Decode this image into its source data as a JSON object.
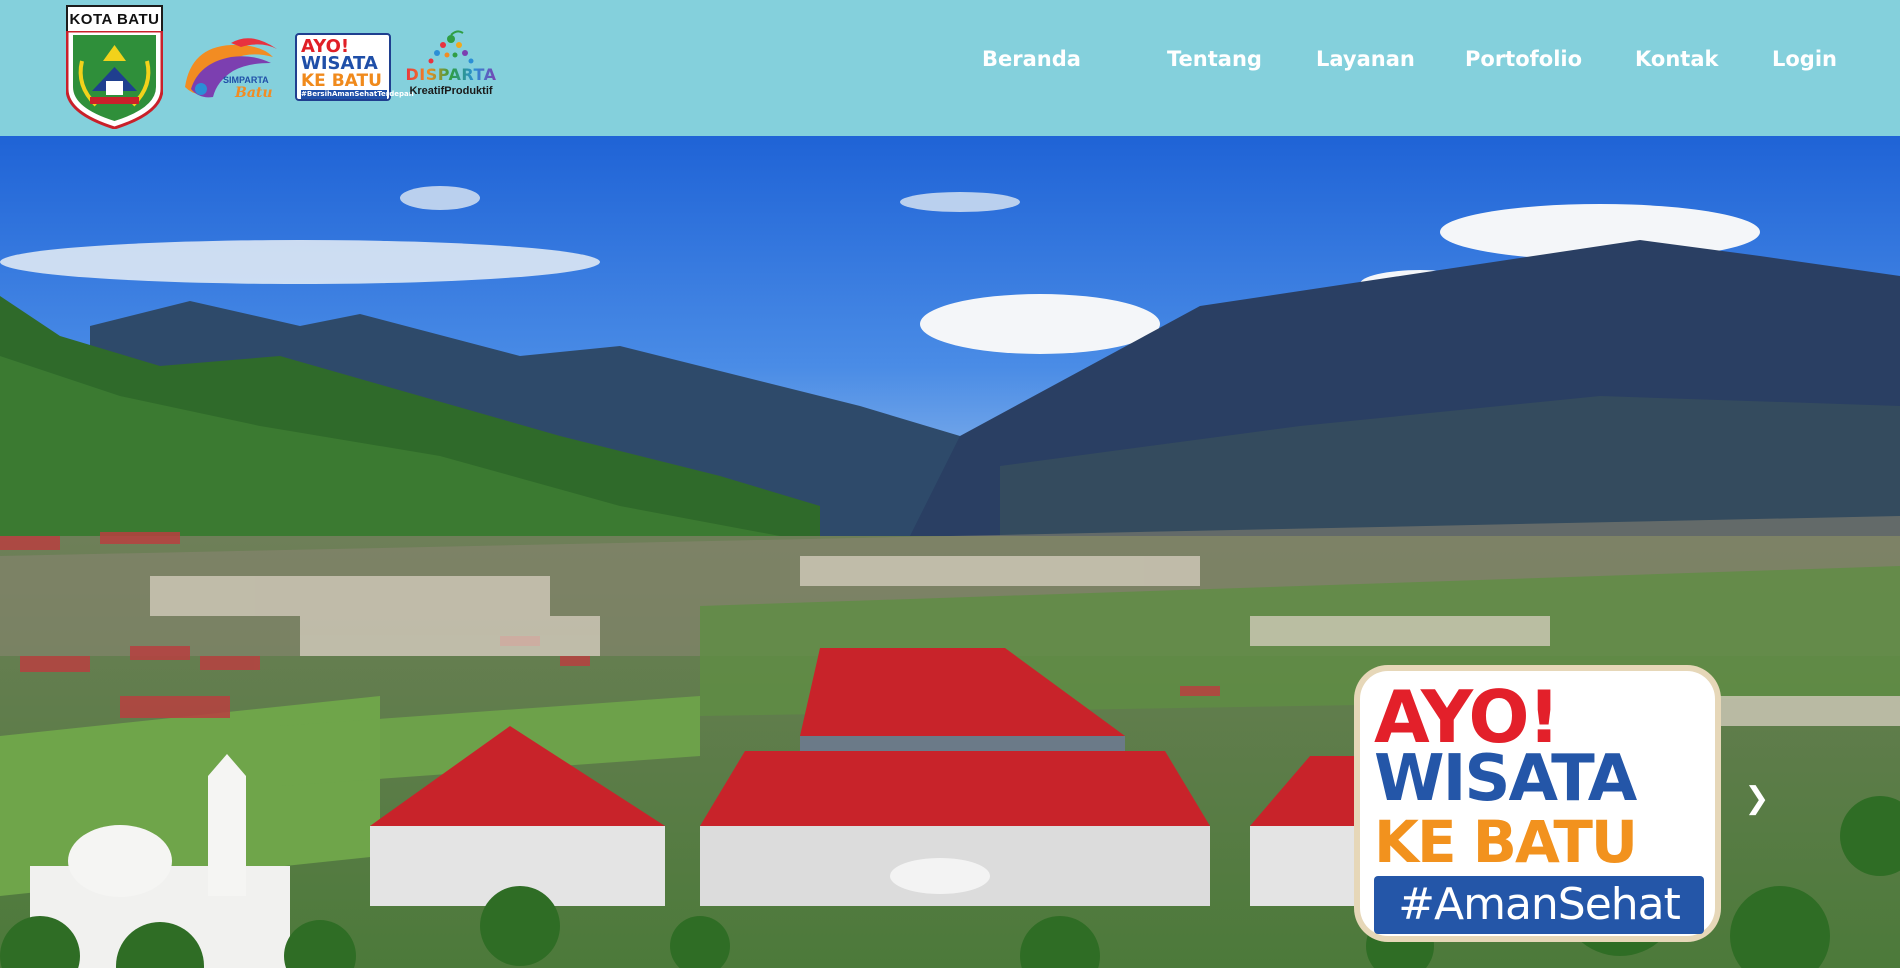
{
  "header": {
    "logos": {
      "kota_batu": {
        "label": "KOTA BATU"
      },
      "simparta": {
        "text_top": "SIMPARTA",
        "text_bottom": "Batu"
      },
      "ayo_wisata_small": {
        "line1": "AYO!",
        "line2": "WISATA",
        "line3": "KE BATU",
        "line4": "#BersihAmanSehatTerdepan"
      },
      "disparta": {
        "word": "DISPARTA",
        "sub": "KreatifProduktif"
      }
    },
    "nav": [
      {
        "label": "Beranda"
      },
      {
        "label": "Tentang"
      },
      {
        "label": "Layanan"
      },
      {
        "label": "Portofolio"
      },
      {
        "label": "Kontak"
      },
      {
        "label": "Login"
      }
    ]
  },
  "hero": {
    "badge": {
      "line1": "AYO!",
      "line2": "WISATA",
      "line3": "KE BATU",
      "line4": "#AmanSehat"
    },
    "next_icon": "chevron-right-icon",
    "next_glyph": "❯"
  },
  "colors": {
    "header_bg": "#84d0dc",
    "nav_text": "#ffffff",
    "badge_red": "#e3202a",
    "badge_blue": "#2456a8",
    "badge_orange": "#f2921e"
  }
}
